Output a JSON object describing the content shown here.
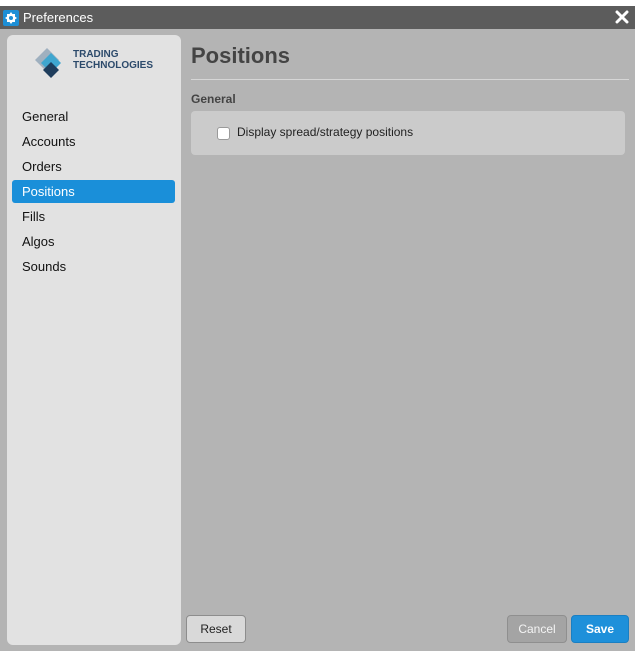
{
  "window": {
    "title": "Preferences"
  },
  "icons": {
    "app": "app-settings-icon",
    "close": "close-icon",
    "logo": "trading-technologies-logo-icon"
  },
  "logo": {
    "line1": "TRADING",
    "line2": "TECHNOLOGIES"
  },
  "sidebar": {
    "items": [
      {
        "label": "General",
        "active": false
      },
      {
        "label": "Accounts",
        "active": false
      },
      {
        "label": "Orders",
        "active": false
      },
      {
        "label": "Positions",
        "active": true
      },
      {
        "label": "Fills",
        "active": false
      },
      {
        "label": "Algos",
        "active": false
      },
      {
        "label": "Sounds",
        "active": false
      }
    ]
  },
  "main": {
    "title": "Positions",
    "section_label": "General",
    "options": [
      {
        "label": "Display spread/strategy positions",
        "checked": false
      }
    ]
  },
  "footer": {
    "reset_label": "Reset",
    "cancel_label": "Cancel",
    "save_label": "Save"
  },
  "colors": {
    "accent": "#1a8fd9",
    "titlebar": "#5c5c5c",
    "window_bg": "#b4b4b4",
    "sidebar_bg": "#e2e2e2"
  }
}
